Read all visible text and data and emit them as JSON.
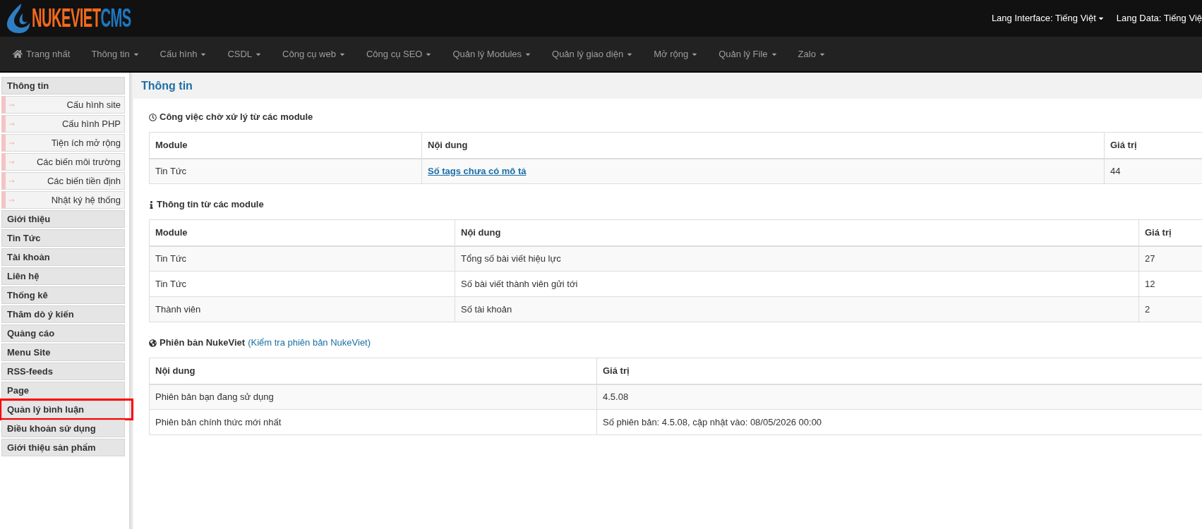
{
  "header": {
    "logo": {
      "brand": "NUKEVIET",
      "suffix": "CMS"
    },
    "languages": [
      {
        "label": "Lang Interface: Tiếng Việt",
        "caret": true
      },
      {
        "label": "Lang Data: Tiếng Việ",
        "caret": false
      }
    ]
  },
  "nav": [
    {
      "label": "Trang nhất",
      "kind": "home"
    },
    {
      "label": "Thông tin",
      "kind": "dropdown"
    },
    {
      "label": "Cấu hình",
      "kind": "dropdown"
    },
    {
      "label": "CSDL",
      "kind": "dropdown"
    },
    {
      "label": "Công cụ web",
      "kind": "dropdown"
    },
    {
      "label": "Công cụ SEO",
      "kind": "dropdown"
    },
    {
      "label": "Quản lý Modules",
      "kind": "dropdown"
    },
    {
      "label": "Quản lý giao diện",
      "kind": "dropdown"
    },
    {
      "label": "Mở rộng",
      "kind": "dropdown"
    },
    {
      "label": "Quản lý File",
      "kind": "dropdown"
    },
    {
      "label": "Zalo",
      "kind": "dropdown"
    }
  ],
  "sidebar": {
    "items": [
      {
        "label": "Thông tin",
        "highlighted": false,
        "children": [
          {
            "label": "Cấu hình site"
          },
          {
            "label": "Cấu hình PHP"
          },
          {
            "label": "Tiện ích mở rộng"
          },
          {
            "label": "Các biến môi trường"
          },
          {
            "label": "Các biến tiền định"
          },
          {
            "label": "Nhật ký hệ thống"
          }
        ]
      },
      {
        "label": "Giới thiệu",
        "highlighted": false
      },
      {
        "label": "Tin Tức",
        "highlighted": false
      },
      {
        "label": "Tài khoản",
        "highlighted": false
      },
      {
        "label": "Liên hệ",
        "highlighted": false
      },
      {
        "label": "Thống kê",
        "highlighted": false
      },
      {
        "label": "Thăm dò ý kiến",
        "highlighted": false
      },
      {
        "label": "Quảng cáo",
        "highlighted": false
      },
      {
        "label": "Menu Site",
        "highlighted": false
      },
      {
        "label": "RSS-feeds",
        "highlighted": false
      },
      {
        "label": "Page",
        "highlighted": false
      },
      {
        "label": "Quản lý bình luận",
        "highlighted": true
      },
      {
        "label": "Điều khoản sử dụng",
        "highlighted": false
      },
      {
        "label": "Giới thiệu sản phẩm",
        "highlighted": false
      }
    ]
  },
  "main": {
    "title": "Thông tin",
    "sections": [
      {
        "kind": "tasks",
        "title": "Công việc chờ xử lý từ các module",
        "columns": [
          "Module",
          "Nội dung",
          "Giá trị"
        ],
        "rows": [
          [
            {
              "text": "Tin Tức",
              "kind": "text"
            },
            {
              "text": "Số tags chưa có mô tả",
              "kind": "link"
            },
            {
              "text": "44",
              "kind": "text"
            }
          ]
        ]
      },
      {
        "kind": "info",
        "title": "Thông tin từ các module",
        "columns": [
          "Module",
          "Nội dung",
          "Giá trị"
        ],
        "rows": [
          [
            {
              "text": "Tin Tức",
              "kind": "text"
            },
            {
              "text": "Tổng số bài viết hiệu lực",
              "kind": "text"
            },
            {
              "text": "27",
              "kind": "text"
            }
          ],
          [
            {
              "text": "Tin Tức",
              "kind": "text"
            },
            {
              "text": "Số bài viết thành viên gửi tới",
              "kind": "text"
            },
            {
              "text": "12",
              "kind": "text"
            }
          ],
          [
            {
              "text": "Thành viên",
              "kind": "text"
            },
            {
              "text": "Số tài khoản",
              "kind": "text"
            },
            {
              "text": "2",
              "kind": "text"
            }
          ]
        ]
      },
      {
        "kind": "version",
        "title": "Phiên bản NukeViet",
        "link": "(Kiểm tra phiên bản NukeViet)",
        "columns": [
          "Nội dung",
          "Giá trị"
        ],
        "rows": [
          [
            {
              "text": "Phiên bản bạn đang sử dụng",
              "kind": "text"
            },
            {
              "text": "4.5.08",
              "kind": "text"
            }
          ],
          [
            {
              "text": "Phiên bản chính thức mới nhất",
              "kind": "text"
            },
            {
              "text": "Số phiên bản: 4.5.08, cập nhật vào: 08/05/2026 00:00",
              "kind": "text"
            }
          ]
        ]
      }
    ]
  }
}
